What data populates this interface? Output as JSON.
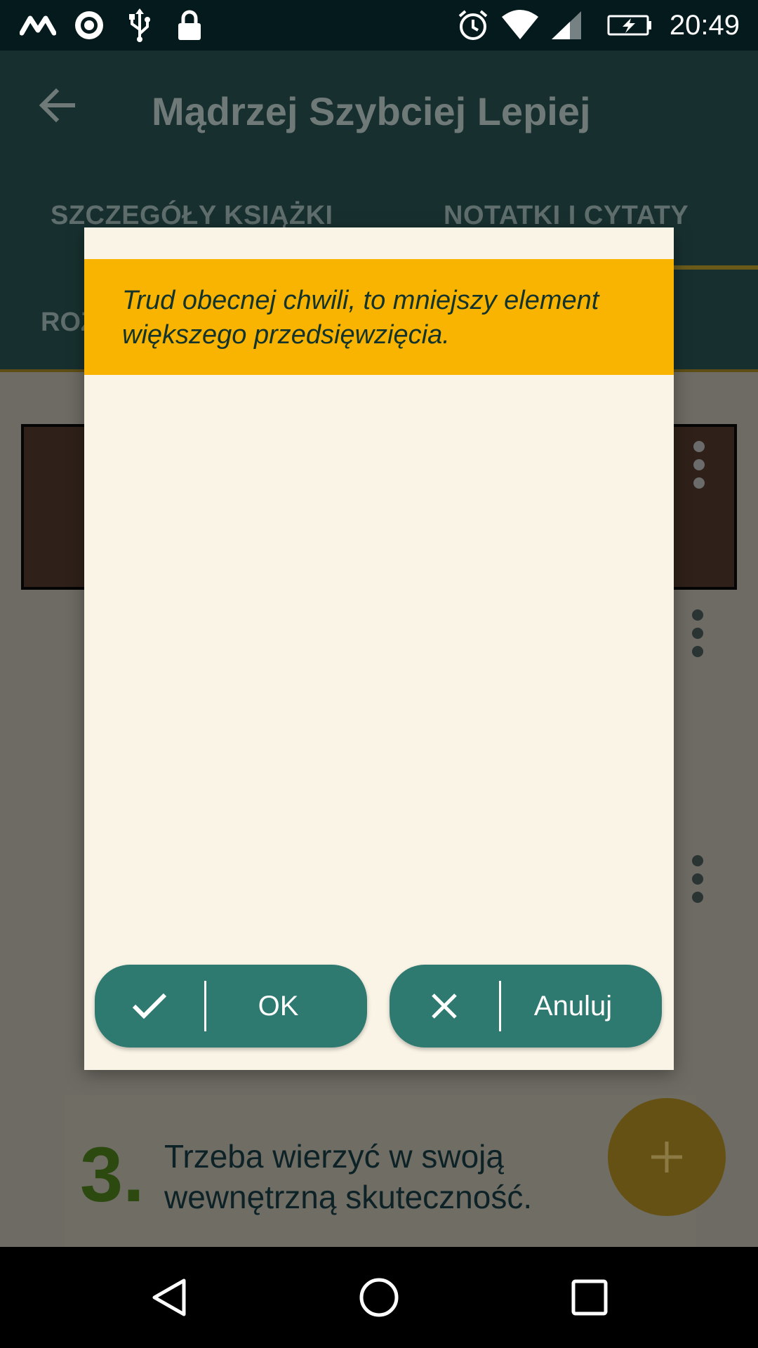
{
  "status_bar": {
    "time": "20:49",
    "left_icons": [
      "motorola-icon",
      "sync-icon",
      "usb-icon",
      "lock-icon"
    ],
    "right_icons": [
      "alarm-icon",
      "wifi-icon",
      "signal-icon",
      "battery-charging-icon"
    ]
  },
  "app_bar": {
    "title": "Mądrzej Szybciej Lepiej",
    "tabs": [
      {
        "label": "SZCZEGÓŁY KSIĄŻKI"
      },
      {
        "label": "NOTATKI I CYTATY"
      }
    ],
    "subtab_label": "ROZ"
  },
  "dialog": {
    "quote": "Trud obecnej chwili, to mniejszy element większego przedsięwzięcia.",
    "ok_label": "OK",
    "cancel_label": "Anuluj"
  },
  "notes": [
    {
      "number": "3.",
      "text": "Trzeba wierzyć w swoją wewnętrzną skuteczność."
    }
  ],
  "colors": {
    "primary": "#2e7a70",
    "accent": "#f8b400",
    "dialog_bg": "#faf4e6"
  }
}
